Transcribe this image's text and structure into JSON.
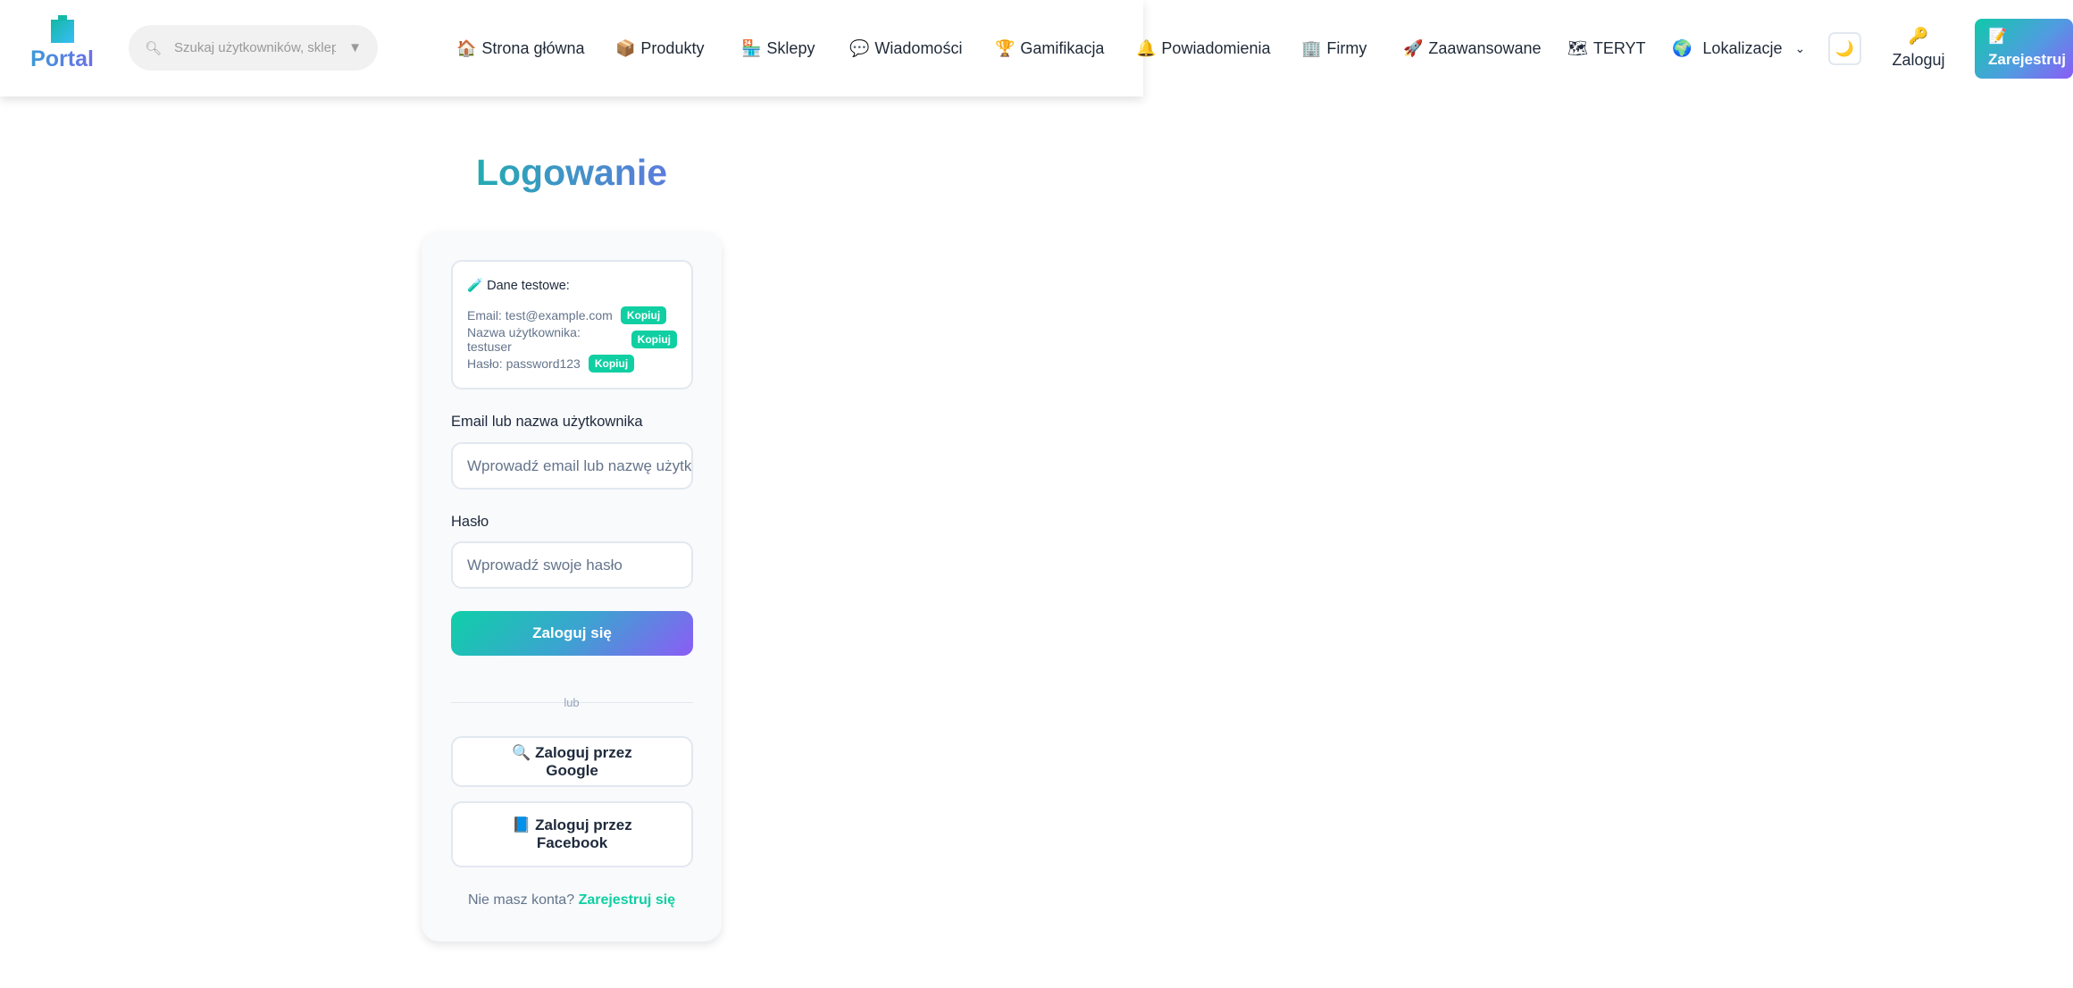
{
  "header": {
    "logo": "Portal",
    "search_placeholder": "Szukaj użytkowników, sklep",
    "nav": [
      {
        "icon": "🏠",
        "label": "Strona główna"
      },
      {
        "icon": "📦",
        "label": "Produkty"
      },
      {
        "icon": "🏪",
        "label": "Sklepy"
      },
      {
        "icon": "💬",
        "label": "Wiadomości"
      },
      {
        "icon": "🏆",
        "label": "Gamifikacja"
      },
      {
        "icon": "🔔",
        "label": "Powiadomienia"
      },
      {
        "icon": "🏢",
        "label": "Firmy"
      },
      {
        "icon": "🚀",
        "label": "Zaawansowane"
      },
      {
        "icon": "🗺",
        "label": "TERYT"
      },
      {
        "icon": "🌍",
        "label": "Lokalizacje"
      }
    ],
    "theme_icon": "🌙",
    "login_icon": "🔑",
    "login": "Zaloguj",
    "register_icon": "📝",
    "register": "Zarejestruj"
  },
  "page": {
    "title": "Logowanie",
    "test_data": {
      "icon": "🧪",
      "title": "Dane testowe:",
      "rows": [
        {
          "text": "Email: test@example.com",
          "button": "Kopiuj"
        },
        {
          "text": "Nazwa użytkownika: testuser",
          "button": "Kopiuj"
        },
        {
          "text": "Hasło: password123",
          "button": "Kopiuj"
        }
      ]
    },
    "email_label": "Email lub nazwa użytkownika",
    "email_placeholder": "Wprowadź email lub nazwę użytk",
    "password_label": "Hasło",
    "password_placeholder": "Wprowadź swoje hasło",
    "submit": "Zaloguj się",
    "divider": "lub",
    "google": "🔍 Zaloguj przez Google",
    "facebook": "📘 Zaloguj przez Facebook",
    "footer_text": "Nie masz konta?",
    "footer_link": "Zarejestruj się"
  }
}
